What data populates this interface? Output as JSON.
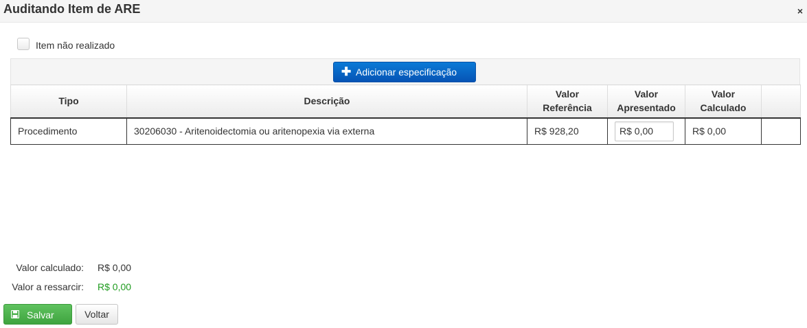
{
  "window": {
    "title": "Auditando Item de ARE",
    "close_glyph": "×"
  },
  "checkbox": {
    "label": "Item não realizado",
    "checked": false
  },
  "toolbar": {
    "add_icon": "plus-icon",
    "add_label": "Adicionar especificação"
  },
  "table": {
    "headers": {
      "tipo": "Tipo",
      "descricao": "Descrição",
      "valor_referencia": [
        "Valor",
        "Referência"
      ],
      "valor_apresentado": [
        "Valor",
        "Apresentado"
      ],
      "valor_calculado": [
        "Valor",
        "Calculado"
      ],
      "acoes": ""
    },
    "rows": [
      {
        "tipo": "Procedimento",
        "descricao": "30206030 - Aritenoidectomia ou aritenopexia via externa",
        "valor_referencia": "R$ 928,20",
        "valor_apresentado": "R$ 0,00",
        "valor_calculado": "R$ 0,00"
      }
    ]
  },
  "summary": {
    "calculado_label": "Valor calculado:",
    "calculado_value": "R$ 0,00",
    "ressarcir_label": "Valor a ressarcir:",
    "ressarcir_value": "R$ 0,00",
    "ressarcir_color": "#1e9b1e"
  },
  "actions": {
    "save_icon": "floppy-disk-icon",
    "save_label": "Salvar",
    "back_label": "Voltar"
  },
  "colors": {
    "primary": "#0654b5",
    "success": "#3fa43f"
  }
}
